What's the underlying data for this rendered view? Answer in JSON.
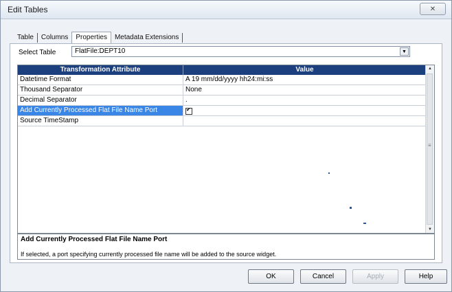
{
  "window": {
    "title": "Edit Tables",
    "close_label": "✕"
  },
  "tabs": [
    {
      "label": "Table"
    },
    {
      "label": "Columns"
    },
    {
      "label": "Properties"
    },
    {
      "label": "Metadata Extensions"
    }
  ],
  "active_tab": "Properties",
  "select_table": {
    "label": "Select Table",
    "value": "FlatFile:DEPT10"
  },
  "grid": {
    "headers": [
      "Transformation Attribute",
      "Value"
    ],
    "rows": [
      {
        "attribute": "Datetime Format",
        "value": "A  19 mm/dd/yyyy hh24:mi:ss"
      },
      {
        "attribute": "Thousand Separator",
        "value": "None"
      },
      {
        "attribute": "Decimal Separator",
        "value": "."
      },
      {
        "attribute": "Add Currently Processed Flat File Name Port",
        "value": "",
        "checked": true,
        "selected": true
      },
      {
        "attribute": "Source TimeStamp",
        "value": ""
      }
    ]
  },
  "description": {
    "title": "Add Currently Processed Flat File Name Port",
    "text": "If selected, a port specifying currently processed file name will be added to the source widget."
  },
  "buttons": {
    "ok": "OK",
    "cancel": "Cancel",
    "apply": "Apply",
    "help": "Help"
  },
  "colors": {
    "header_bg": "#1c3f7e",
    "selected_bg": "#3a86e6"
  }
}
